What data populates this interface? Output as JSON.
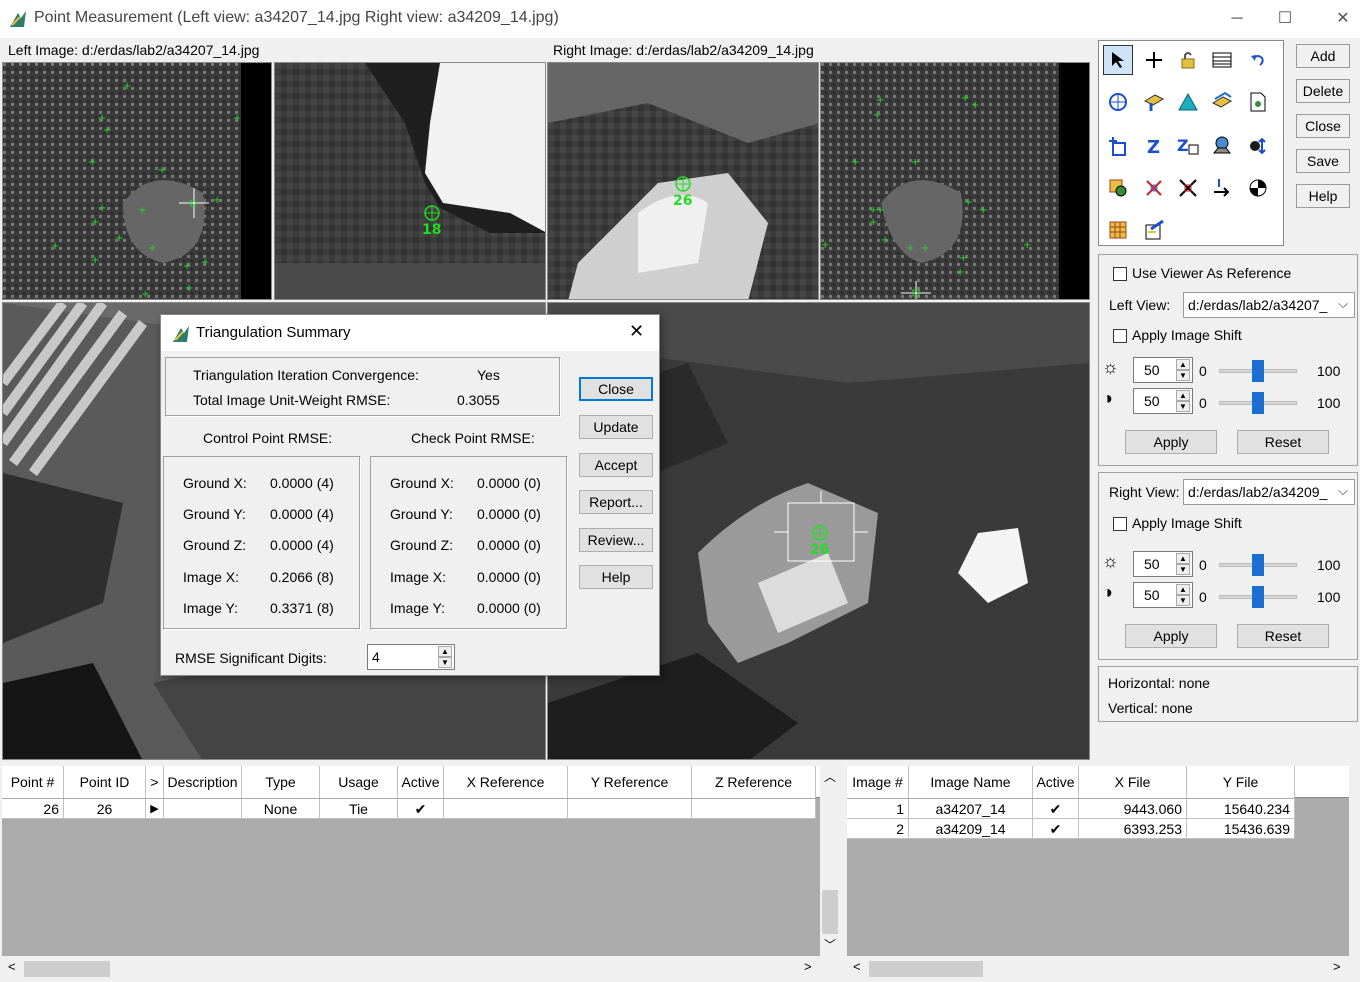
{
  "window": {
    "title": "Point Measurement (Left view: a34207_14.jpg  Right view: a34209_14.jpg)",
    "minimize": "─",
    "maximize": "☐",
    "close": "✕"
  },
  "left_image_label": "Left Image: d:/erdas/lab2/a34207_14.jpg",
  "right_image_label": "Right Image: d:/erdas/lab2/a34209_14.jpg",
  "viewer_points": {
    "left_zoom_point": "18",
    "right_zoom_point": "26",
    "main_right_point": "26"
  },
  "side_buttons": {
    "add": "Add",
    "delete": "Delete",
    "close": "Close",
    "save": "Save",
    "help": "Help"
  },
  "reference_panel": {
    "use_viewer_as_reference": "Use Viewer As Reference",
    "left_view_label": "Left View:",
    "left_view_value": "d:/erdas/lab2/a34207_",
    "apply_image_shift": "Apply Image Shift",
    "brightness": "50",
    "contrast": "50",
    "min": "0",
    "max": "100",
    "apply": "Apply",
    "reset": "Reset"
  },
  "right_panel": {
    "right_view_label": "Right View:",
    "right_view_value": "d:/erdas/lab2/a34209_",
    "apply_image_shift": "Apply Image Shift",
    "brightness": "50",
    "contrast": "50",
    "min": "0",
    "max": "100",
    "apply": "Apply",
    "reset": "Reset"
  },
  "status": {
    "horizontal": "Horizontal: none",
    "vertical": "Vertical: none"
  },
  "dialog": {
    "title": "Triangulation Summary",
    "convergence_label": "Triangulation Iteration Convergence:",
    "convergence_value": "Yes",
    "rmse_label": "Total Image Unit-Weight RMSE:",
    "rmse_value": "0.3055",
    "control_header": "Control Point RMSE:",
    "check_header": "Check Point RMSE:",
    "control_rows": [
      {
        "label": "Ground X:",
        "value": "0.0000 (4)"
      },
      {
        "label": "Ground Y:",
        "value": "0.0000 (4)"
      },
      {
        "label": "Ground Z:",
        "value": "0.0000 (4)"
      },
      {
        "label": "Image X:",
        "value": "0.2066 (8)"
      },
      {
        "label": "Image Y:",
        "value": "0.3371 (8)"
      }
    ],
    "check_rows": [
      {
        "label": "Ground X:",
        "value": "0.0000 (0)"
      },
      {
        "label": "Ground Y:",
        "value": "0.0000 (0)"
      },
      {
        "label": "Ground Z:",
        "value": "0.0000 (0)"
      },
      {
        "label": "Image X:",
        "value": "0.0000 (0)"
      },
      {
        "label": "Image Y:",
        "value": "0.0000 (0)"
      }
    ],
    "digits_label": "RMSE Significant Digits:",
    "digits_value": "4",
    "buttons": {
      "close": "Close",
      "update": "Update",
      "accept": "Accept",
      "report": "Report...",
      "review": "Review...",
      "help": "Help"
    }
  },
  "point_table": {
    "headers": [
      "Point #",
      "Point ID",
      ">",
      "Description",
      "Type",
      "Usage",
      "Active",
      "X Reference",
      "Y Reference",
      "Z Reference"
    ],
    "rows": [
      {
        "point_num": "26",
        "point_id": "26",
        "marker": "▶",
        "description": "",
        "type": "None",
        "usage": "Tie",
        "active": "✔",
        "x_ref": "",
        "y_ref": "",
        "z_ref": ""
      }
    ]
  },
  "image_table": {
    "headers": [
      "Image #",
      "Image Name",
      "Active",
      "X File",
      "Y File"
    ],
    "rows": [
      {
        "image_num": "1",
        "name": "a34207_14",
        "active": "✔",
        "x_file": "9443.060",
        "y_file": "15640.234"
      },
      {
        "image_num": "2",
        "name": "a34209_14",
        "active": "✔",
        "x_file": "6393.253",
        "y_file": "15436.639"
      }
    ]
  }
}
